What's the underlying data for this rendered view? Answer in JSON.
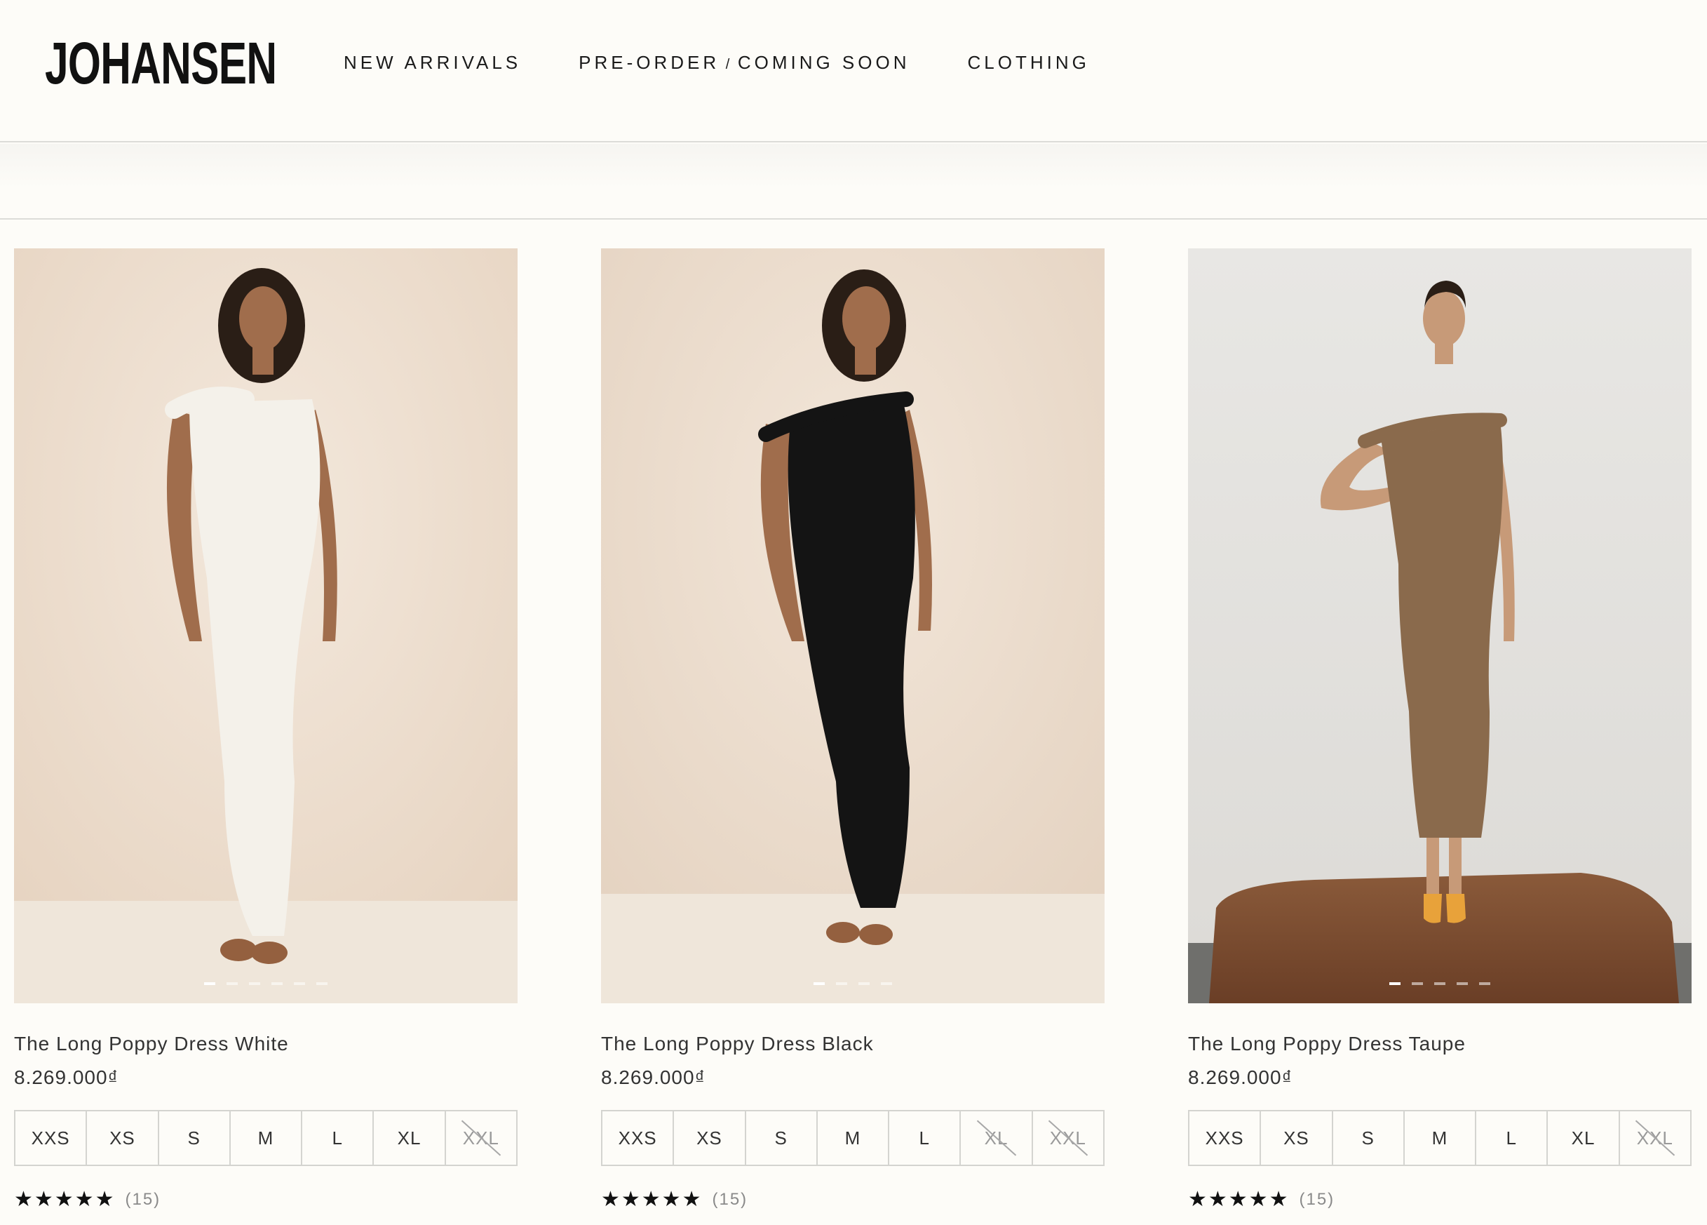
{
  "brand": {
    "logo_text": "JOHANSEN"
  },
  "nav": {
    "items": [
      {
        "label": "NEW ARRIVALS"
      },
      {
        "label_a": "PRE-ORDER",
        "label_sep": " / ",
        "label_b": "COMING SOON"
      },
      {
        "label": "CLOTHING"
      }
    ]
  },
  "products": [
    {
      "title": "The Long Poppy Dress White",
      "price": "8.269.000₫",
      "dress_color": "#f4f1ea",
      "background_color": "#eee0d2",
      "image_dots": 6,
      "sizes": [
        {
          "label": "XXS",
          "available": true
        },
        {
          "label": "XS",
          "available": true
        },
        {
          "label": "S",
          "available": true
        },
        {
          "label": "M",
          "available": true
        },
        {
          "label": "L",
          "available": true
        },
        {
          "label": "XL",
          "available": true
        },
        {
          "label": "XXL",
          "available": false
        }
      ],
      "stars": "★★★★★",
      "rating_value": 5,
      "review_count": "(15)"
    },
    {
      "title": "The Long Poppy Dress Black",
      "price": "8.269.000₫",
      "dress_color": "#141414",
      "background_color": "#ecdfd2",
      "image_dots": 4,
      "sizes": [
        {
          "label": "XXS",
          "available": true
        },
        {
          "label": "XS",
          "available": true
        },
        {
          "label": "S",
          "available": true
        },
        {
          "label": "M",
          "available": true
        },
        {
          "label": "L",
          "available": true
        },
        {
          "label": "XL",
          "available": false
        },
        {
          "label": "XXL",
          "available": false
        }
      ],
      "stars": "★★★★★",
      "rating_value": 5,
      "review_count": "(15)"
    },
    {
      "title": "The Long Poppy Dress Taupe",
      "price": "8.269.000₫",
      "dress_color": "#8a6a4c",
      "background_color": "#e4e2de",
      "image_dots": 5,
      "sizes": [
        {
          "label": "XXS",
          "available": true
        },
        {
          "label": "XS",
          "available": true
        },
        {
          "label": "S",
          "available": true
        },
        {
          "label": "M",
          "available": true
        },
        {
          "label": "L",
          "available": true
        },
        {
          "label": "XL",
          "available": true
        },
        {
          "label": "XXL",
          "available": false
        }
      ],
      "stars": "★★★★★",
      "rating_value": 5,
      "review_count": "(15)"
    }
  ]
}
